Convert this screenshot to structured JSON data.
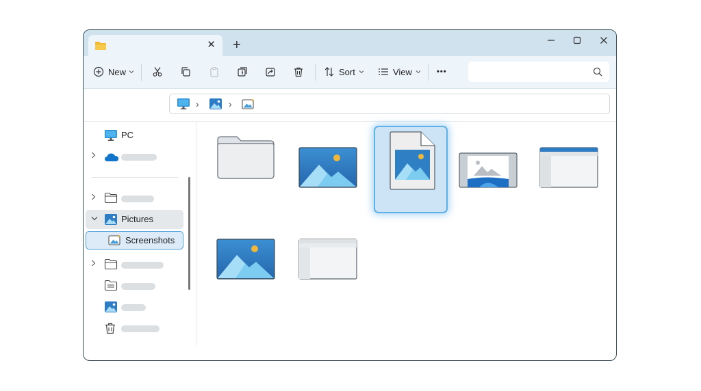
{
  "window": {
    "tab_close_glyph": "✕",
    "new_tab_glyph": "+",
    "minimize_glyph": "—",
    "close_glyph": "✕"
  },
  "toolbar": {
    "new_label": "New",
    "sort_label": "Sort",
    "view_label": "View",
    "more_glyph": "•••"
  },
  "sidebar": {
    "items": [
      {
        "label": "PC",
        "icon": "monitor-icon"
      },
      {
        "label": "",
        "icon": "onedrive-icon"
      },
      {
        "label": "",
        "icon": "folder-icon"
      },
      {
        "label": "Pictures",
        "icon": "pictures-icon"
      },
      {
        "label": "Screenshots",
        "icon": "screenshots-icon"
      },
      {
        "label": "",
        "icon": "folder-icon"
      },
      {
        "label": "",
        "icon": "documents-icon"
      },
      {
        "label": "",
        "icon": "image-icon"
      },
      {
        "label": "",
        "icon": "trash-icon"
      }
    ]
  },
  "content": {
    "files": [
      {
        "kind": "folder"
      },
      {
        "kind": "image"
      },
      {
        "kind": "image-file",
        "selected": true
      },
      {
        "kind": "screenshot"
      },
      {
        "kind": "window-screenshot"
      },
      {
        "kind": "image"
      },
      {
        "kind": "window-screenshot"
      }
    ]
  },
  "colors": {
    "accent": "#4a9fd8",
    "titlebar": "#cfe2ee",
    "selection": "#cde4f7"
  }
}
